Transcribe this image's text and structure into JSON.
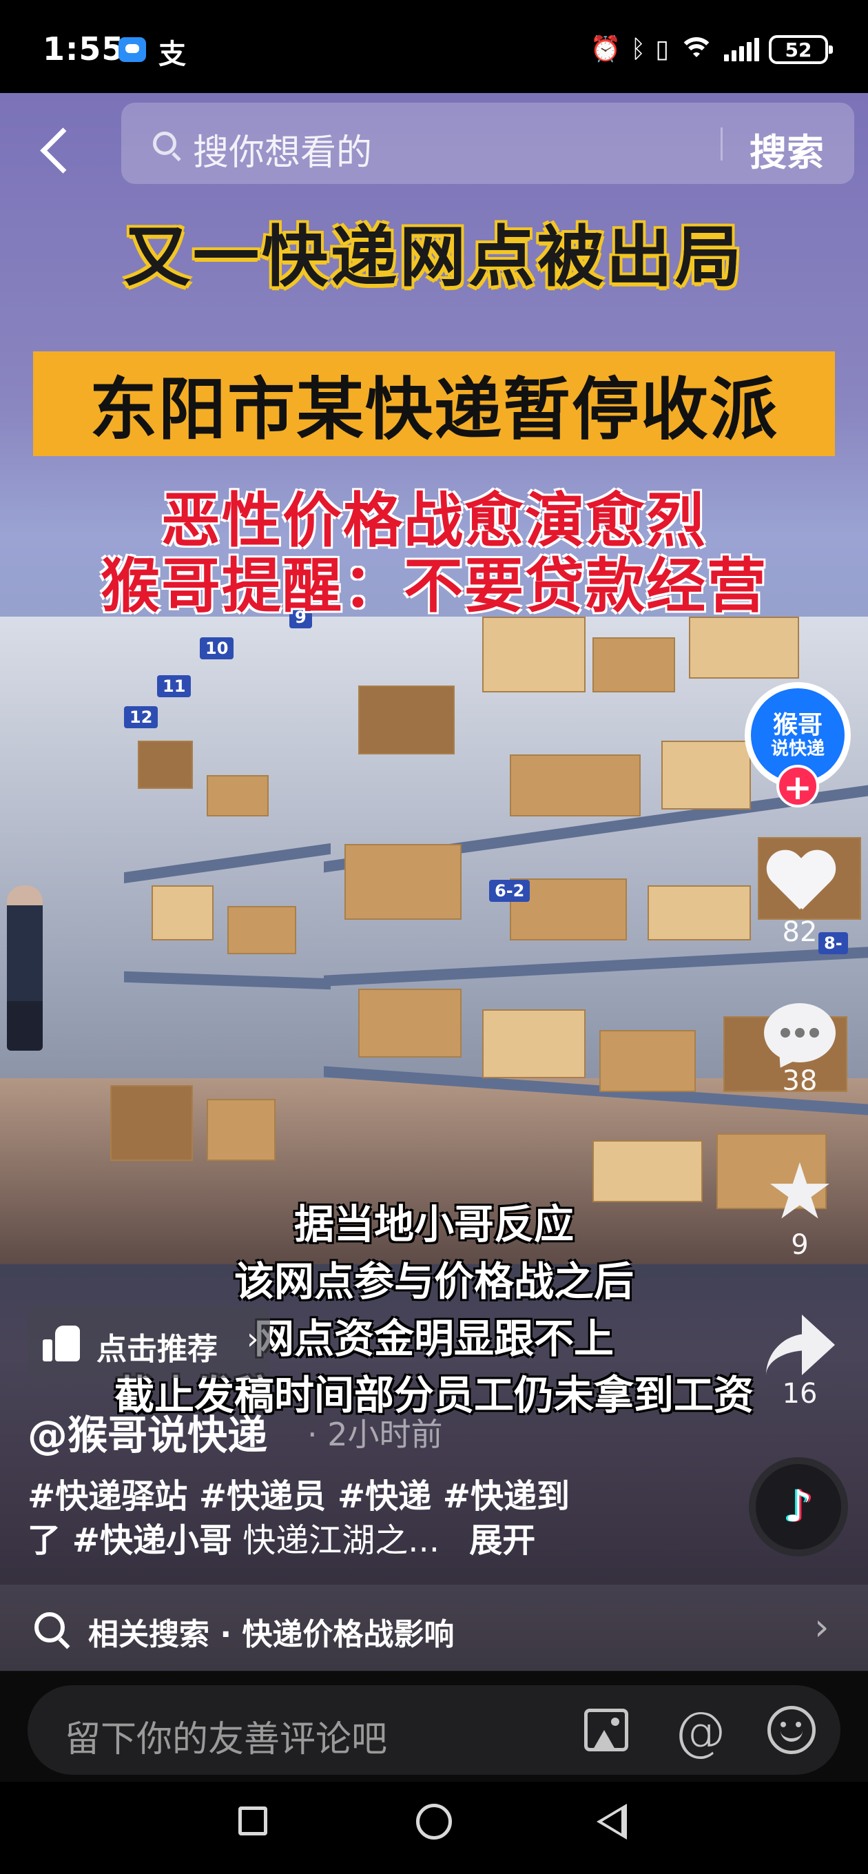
{
  "status_bar": {
    "time": "1:55",
    "alipay_glyph": "支",
    "battery": "52",
    "icons": [
      "message-app-icon",
      "alipay-icon",
      "alarm-icon",
      "bluetooth-icon",
      "vibrate-icon",
      "wifi-icon",
      "signal-icon",
      "battery-icon"
    ]
  },
  "search": {
    "placeholder": "搜你想看的",
    "button_label": "搜索"
  },
  "video": {
    "title_line": "又一快递网点被出局",
    "headline": "东阳市某快递暂停收派",
    "red_line_1": "恶性价格战愈演愈烈",
    "red_line_2": "猴哥提醒：不要贷款经营",
    "subtitles": [
      "据当地小哥反应",
      "该网点参与价格战之后",
      "网点资金明显跟不上",
      "截止发稿时间部分员工仍未拿到工资"
    ],
    "shelf_tags": [
      "9",
      "10",
      "11",
      "12",
      "6-2",
      "8-"
    ],
    "colors": {
      "title_yellow": "#f4ad25",
      "warning_red": "#e4172d"
    }
  },
  "author_avatar": {
    "line1": "猴哥",
    "line2": "说快递"
  },
  "actions": {
    "likes": "82",
    "comments": "38",
    "favorites": "9",
    "shares": "16"
  },
  "recommend": {
    "label": "点击推荐",
    "chevron": "›"
  },
  "post": {
    "author": "@猴哥说快递",
    "time": "· 2小时前",
    "hashtags_line1": "#快递驿站 #快递员 #快递 #快递到",
    "hashtags_line2_tags": "了 #快递小哥",
    "hashtags_line2_text": "快递江湖之...",
    "expand": "展开"
  },
  "related_search": {
    "text": "相关搜索 · 快递价格战影响",
    "chevron": "›"
  },
  "comment_bar": {
    "placeholder": "留下你的友善评论吧",
    "at_symbol": "@"
  },
  "music_disc": {
    "glyph": "♪"
  }
}
